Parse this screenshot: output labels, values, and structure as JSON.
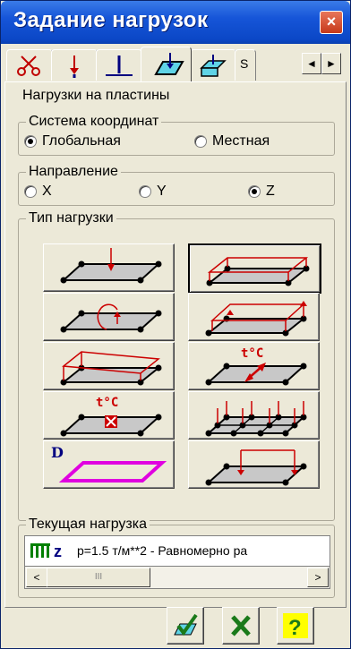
{
  "window": {
    "title": "Задание нагрузок",
    "close_label": "×"
  },
  "tabs": {
    "items": [
      {
        "icon": "scissors-icon"
      },
      {
        "icon": "arrow-down-icon"
      },
      {
        "icon": "support-icon"
      },
      {
        "icon": "plate-load-icon",
        "active": true
      },
      {
        "icon": "solid-load-icon"
      }
    ],
    "overflow_label": "S",
    "left_arrow": "◄",
    "right_arrow": "►"
  },
  "section": {
    "heading": "Нагрузки на пластины"
  },
  "coordinate_system": {
    "label": "Система координат",
    "options": [
      {
        "label": "Глобальная",
        "selected": true
      },
      {
        "label": "Местная",
        "selected": false
      }
    ]
  },
  "direction": {
    "label": "Направление",
    "options": [
      {
        "label": "X",
        "selected": false
      },
      {
        "label": "Y",
        "selected": false
      },
      {
        "label": "Z",
        "selected": true
      }
    ]
  },
  "load_type": {
    "label": "Тип нагрузки",
    "buttons": [
      {
        "icon": "point-force-plate-icon"
      },
      {
        "icon": "uniform-load-plate-icon",
        "selected": true
      },
      {
        "icon": "moment-plate-icon"
      },
      {
        "icon": "edge-load-plate-icon"
      },
      {
        "icon": "trapezoid-load-plate-icon"
      },
      {
        "icon": "temperature-gradient-plate-icon",
        "text": "t°C"
      },
      {
        "icon": "temperature-uniform-plate-icon",
        "text": "t°C"
      },
      {
        "icon": "node-loads-plate-icon"
      },
      {
        "icon": "dynamic-load-plate-icon",
        "text": "D"
      },
      {
        "icon": "strip-load-plate-icon"
      }
    ]
  },
  "current_load": {
    "label": "Текущая нагрузка",
    "icon_text": "z",
    "value": "p=1.5 т/м**2 - Равномерно ра",
    "scroll_left": "<",
    "scroll_right": ">",
    "thumb": "III"
  },
  "footer": {
    "buttons": [
      {
        "icon": "apply-check-icon"
      },
      {
        "icon": "cancel-x-icon"
      },
      {
        "icon": "help-question-icon",
        "text": "?"
      }
    ]
  },
  "colors": {
    "title_bar": "#0b47c6",
    "load_red": "#cc0000",
    "plate_fill": "#c8c8c8",
    "dynamic_magenta": "#e000e0",
    "confirm_green": "#2a8a2a"
  }
}
